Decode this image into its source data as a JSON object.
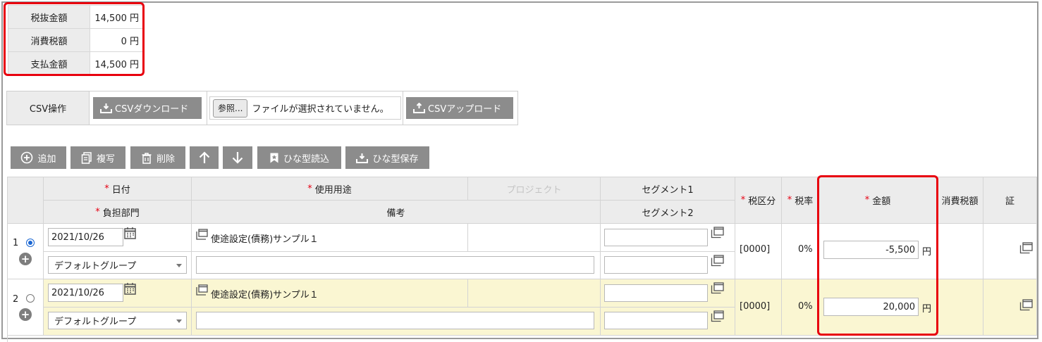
{
  "summary": [
    {
      "label": "税抜金額",
      "value": "14,500 円"
    },
    {
      "label": "消費税額",
      "value": "0 円"
    },
    {
      "label": "支払金額",
      "value": "14,500 円"
    }
  ],
  "csv": {
    "label": "CSV操作",
    "download_label": "CSVダウンロード",
    "browse_label": "参照...",
    "no_file_text": "ファイルが選択されていません。",
    "upload_label": "CSVアップロード"
  },
  "toolbar": {
    "add": "追加",
    "copy": "複写",
    "delete": "削除",
    "template_load": "ひな型読込",
    "template_save": "ひな型保存"
  },
  "headers": {
    "required_mark": "*",
    "date": "日付",
    "usage": "使用用途",
    "project": "プロジェクト",
    "segment1": "セグメント1",
    "tax_class": "税区分",
    "tax_rate": "税率",
    "amount": "金額",
    "consumption_tax": "消費税額",
    "proof": "証",
    "department": "負担部門",
    "remarks": "備考",
    "segment2": "セグメント2"
  },
  "rows": [
    {
      "no": "1",
      "selected": true,
      "date": "2021/10/26",
      "usage": "使途設定(債務)サンプル１",
      "department": "デフォルトグループ",
      "tax_class": "[0000]",
      "tax_rate": "0%",
      "amount": "-5,500",
      "unit": "円"
    },
    {
      "no": "2",
      "selected": false,
      "date": "2021/10/26",
      "usage": "使途設定(債務)サンプル１",
      "department": "デフォルトグループ",
      "tax_class": "[0000]",
      "tax_rate": "0%",
      "amount": "20,000",
      "unit": "円"
    }
  ],
  "colors": {
    "highlight": "#e8000e",
    "button_gray": "#8c8c8c",
    "header_bg": "#ececec",
    "selected_row": "#faf6d2",
    "required": "#e60012"
  }
}
